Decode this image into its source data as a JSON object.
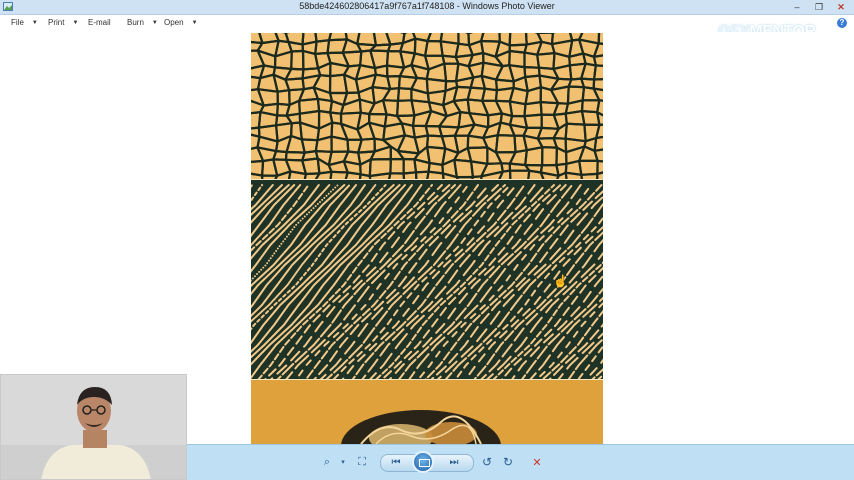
{
  "window": {
    "title": "58bde424602806417a9f767a1f748108 - Windows Photo Viewer",
    "controls": {
      "minimize": "–",
      "maximize": "❐",
      "close": "✕"
    }
  },
  "menu": {
    "items": [
      {
        "label": "File",
        "has_dropdown": true
      },
      {
        "label": "Print",
        "has_dropdown": true
      },
      {
        "label": "E-mail",
        "has_dropdown": false
      },
      {
        "label": "Burn",
        "has_dropdown": true
      },
      {
        "label": "Open",
        "has_dropdown": true
      }
    ],
    "help_icon": "?"
  },
  "watermark": {
    "text_a": "GFX",
    "text_b": "MENTOR"
  },
  "image": {
    "panels": [
      "cracked-earth-pattern",
      "zebra-stripe-pattern",
      "mixed-animal-print-pattern"
    ],
    "colors": {
      "cracked_bg": "#f2c071",
      "cracked_lines": "#1c2a1e",
      "zebra_bg": "#1e3326",
      "zebra_stripes": "#f2c98a",
      "bottom_bg": "#dea13c"
    }
  },
  "toolbar": {
    "buttons": [
      {
        "name": "zoom-icon",
        "glyph": "⌕"
      },
      {
        "name": "actual-size-icon",
        "glyph": "⛶"
      },
      {
        "name": "previous-icon",
        "glyph": "⏮"
      },
      {
        "name": "slideshow-icon",
        "glyph": "▣"
      },
      {
        "name": "next-icon",
        "glyph": "⏭"
      },
      {
        "name": "rotate-ccw-icon",
        "glyph": "↺"
      },
      {
        "name": "rotate-cw-icon",
        "glyph": "↻"
      },
      {
        "name": "delete-icon",
        "glyph": "✕"
      }
    ],
    "colors": {
      "bar": "#bfe0f4",
      "icon": "#2a5d94",
      "delete": "#d0332b"
    }
  },
  "webcam": {
    "present": true
  }
}
